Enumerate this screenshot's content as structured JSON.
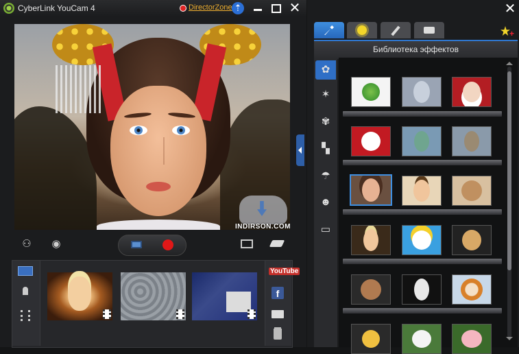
{
  "window": {
    "app_title": "CyberLink YouCam 4",
    "director_zone_label": "DirectorZone"
  },
  "preview": {
    "watermark_text": "INDIRSON.COM"
  },
  "social": {
    "youtube_label": "YouTube",
    "facebook_label": "f"
  },
  "effects_panel": {
    "library_title": "Библиотека эффектов",
    "tabs": [
      "effects-tab",
      "stamps-tab",
      "draw-tab",
      "camera-tab"
    ],
    "active_tab": 0,
    "categories": [
      "avatar-icon",
      "magic-wand-icon",
      "particle-icon",
      "frame-icon",
      "mask-icon",
      "emotion-icon",
      "distortion-icon"
    ],
    "active_category": 0,
    "selected_effect": "avatar-geisha"
  },
  "colors": {
    "accent": "#2f77cf",
    "record": "#e01818",
    "director_zone": "#f0b030"
  }
}
